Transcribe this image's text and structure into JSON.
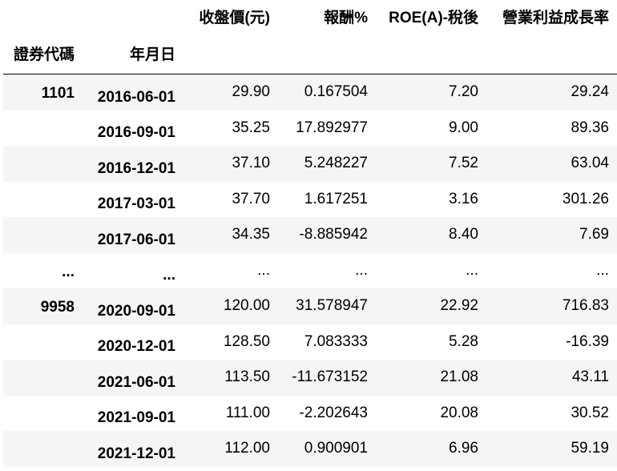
{
  "columns": [
    "收盤價(元)",
    "報酬%",
    "ROE(A)-稅後",
    "營業利益成長率"
  ],
  "index_names": [
    "證券代碼",
    "年月日"
  ],
  "rows": [
    {
      "code": "1101",
      "date": "2016-06-01",
      "close": "29.90",
      "ret": "0.167504",
      "roe": "7.20",
      "growth": "29.24"
    },
    {
      "code": "",
      "date": "2016-09-01",
      "close": "35.25",
      "ret": "17.892977",
      "roe": "9.00",
      "growth": "89.36"
    },
    {
      "code": "",
      "date": "2016-12-01",
      "close": "37.10",
      "ret": "5.248227",
      "roe": "7.52",
      "growth": "63.04"
    },
    {
      "code": "",
      "date": "2017-03-01",
      "close": "37.70",
      "ret": "1.617251",
      "roe": "3.16",
      "growth": "301.26"
    },
    {
      "code": "",
      "date": "2017-06-01",
      "close": "34.35",
      "ret": "-8.885942",
      "roe": "8.40",
      "growth": "7.69"
    },
    {
      "code": "...",
      "date": "...",
      "close": "...",
      "ret": "...",
      "roe": "...",
      "growth": "..."
    },
    {
      "code": "9958",
      "date": "2020-09-01",
      "close": "120.00",
      "ret": "31.578947",
      "roe": "22.92",
      "growth": "716.83"
    },
    {
      "code": "",
      "date": "2020-12-01",
      "close": "128.50",
      "ret": "7.083333",
      "roe": "5.28",
      "growth": "-16.39"
    },
    {
      "code": "",
      "date": "2021-06-01",
      "close": "113.50",
      "ret": "-11.673152",
      "roe": "21.08",
      "growth": "43.11"
    },
    {
      "code": "",
      "date": "2021-09-01",
      "close": "111.00",
      "ret": "-2.202643",
      "roe": "20.08",
      "growth": "30.52"
    },
    {
      "code": "",
      "date": "2021-12-01",
      "close": "112.00",
      "ret": "0.900901",
      "roe": "6.96",
      "growth": "59.19"
    }
  ]
}
